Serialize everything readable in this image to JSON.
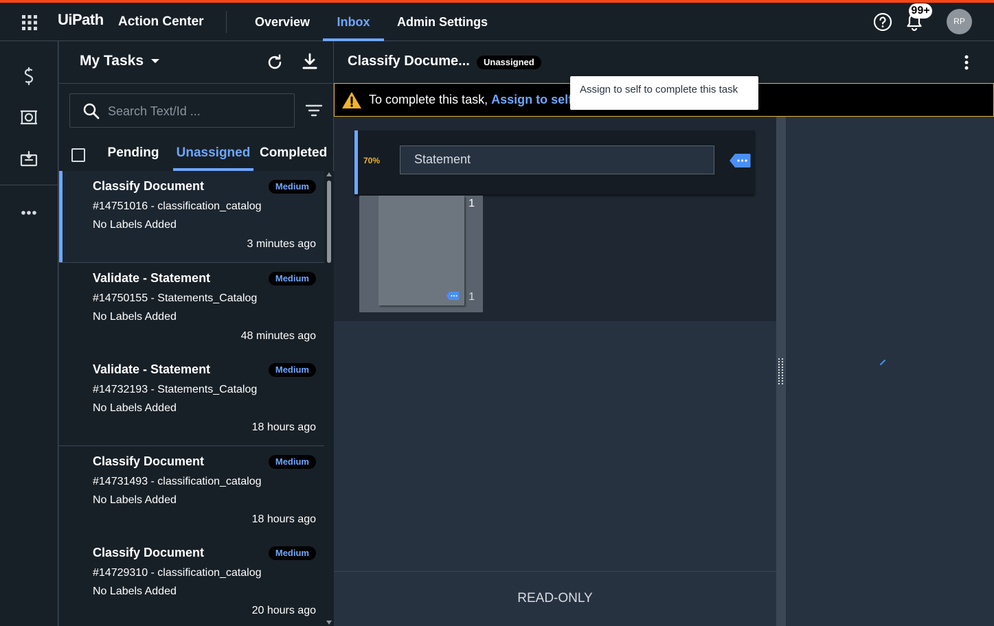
{
  "app": {
    "brand": "UiPath",
    "product": "Action Center",
    "nav": [
      "Overview",
      "Inbox",
      "Admin Settings"
    ],
    "active_nav": "Inbox",
    "notifications_badge": "99+",
    "avatar_initials": "RP",
    "accent_color": "#6ea7ff",
    "stripe_color": "#fa4616"
  },
  "rail": {
    "icons": [
      "processes-icon",
      "monitor-icon",
      "queue-icon",
      "more-icon"
    ]
  },
  "list": {
    "header": "My Tasks",
    "search_placeholder": "Search Text/Id ...",
    "tabs": [
      "Pending",
      "Unassigned",
      "Completed"
    ],
    "active_tab": "Unassigned",
    "tasks": [
      {
        "title": "Classify Document",
        "priority": "Medium",
        "id": "#14751016 - classification_catalog",
        "labels": "No Labels Added",
        "time": "3 minutes ago"
      },
      {
        "title": "Validate - Statement",
        "priority": "Medium",
        "id": "#14750155 - Statements_Catalog",
        "labels": "No Labels Added",
        "time": "48 minutes ago"
      },
      {
        "title": "Validate - Statement",
        "priority": "Medium",
        "id": "#14732193 - Statements_Catalog",
        "labels": "No Labels Added",
        "time": "18 hours ago"
      },
      {
        "title": "Classify Document",
        "priority": "Medium",
        "id": "#14731493 - classification_catalog",
        "labels": "No Labels Added",
        "time": "18 hours ago"
      },
      {
        "title": "Classify Document",
        "priority": "Medium",
        "id": "#14729310 - classification_catalog",
        "labels": "No Labels Added",
        "time": "20 hours ago"
      }
    ]
  },
  "detail": {
    "title": "Classify Docume...",
    "status": "Unassigned",
    "warning_text": "To complete this task, ",
    "warning_link": "Assign to self",
    "tooltip": "Assign to self to complete this task",
    "confidence": "70%",
    "classification": "Statement",
    "page_number_top": "1",
    "page_number_bottom": "1",
    "readonly": "READ-ONLY"
  }
}
